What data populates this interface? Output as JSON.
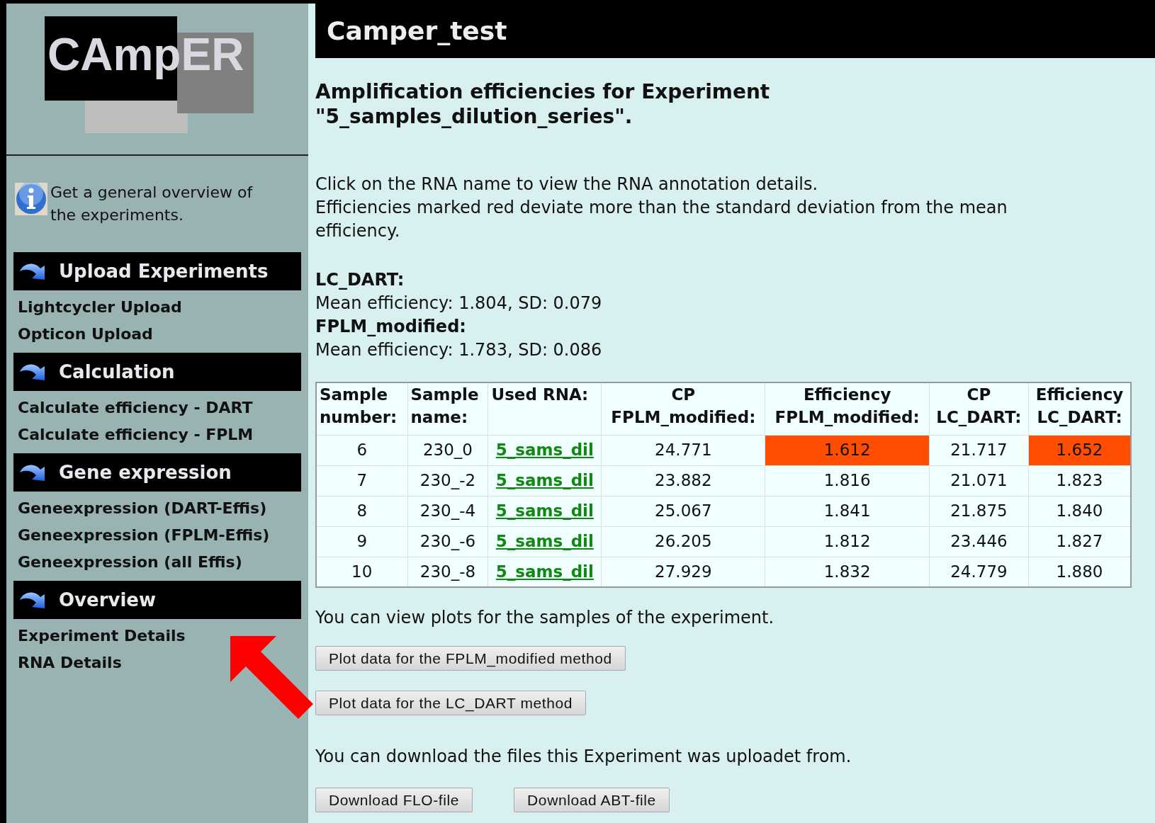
{
  "logo": {
    "text": "CAmpER"
  },
  "sidebar": {
    "info": "Get a general overview of the experiments.",
    "sections": [
      {
        "title": "Upload Experiments",
        "items": [
          "Lightcycler Upload",
          "Opticon Upload"
        ]
      },
      {
        "title": "Calculation",
        "items": [
          "Calculate efficiency - DART",
          "Calculate efficiency - FPLM"
        ]
      },
      {
        "title": "Gene expression",
        "items": [
          "Geneexpression (DART-Effis)",
          "Geneexpression (FPLM-Effis)",
          "Geneexpression (all Effis)"
        ]
      },
      {
        "title": "Overview",
        "items": [
          "Experiment Details",
          "RNA Details"
        ]
      }
    ]
  },
  "header": {
    "title": "Camper_test"
  },
  "heading": [
    "Amplification efficiencies for Experiment",
    "\"5_samples_dilution_series\"."
  ],
  "intro": [
    "Click on the RNA name to view the RNA annotation details.",
    "Efficiencies marked red deviate more than the standard deviation from the mean efficiency."
  ],
  "methods": [
    {
      "name": "LC_DART:",
      "stats": "Mean efficiency: 1.804, SD: 0.079"
    },
    {
      "name": "FPLM_modified:",
      "stats": "Mean efficiency: 1.783, SD: 0.086"
    }
  ],
  "table": {
    "columns": [
      [
        "Sample",
        "number:"
      ],
      [
        "Sample",
        "name:"
      ],
      [
        "Used RNA:"
      ],
      [
        "CP",
        "FPLM_modified:"
      ],
      [
        "Efficiency",
        "FPLM_modified:"
      ],
      [
        "CP",
        "LC_DART:"
      ],
      [
        "Efficiency",
        "LC_DART:"
      ]
    ],
    "rows": [
      {
        "number": "6",
        "name": "230_0",
        "rna": "5_sams_dil",
        "cp_fplm": "24.771",
        "eff_fplm": "1.612",
        "eff_fplm_flagged": true,
        "cp_dart": "21.717",
        "eff_dart": "1.652",
        "eff_dart_flagged": true
      },
      {
        "number": "7",
        "name": "230_-2",
        "rna": "5_sams_dil",
        "cp_fplm": "23.882",
        "eff_fplm": "1.816",
        "eff_fplm_flagged": false,
        "cp_dart": "21.071",
        "eff_dart": "1.823",
        "eff_dart_flagged": false
      },
      {
        "number": "8",
        "name": "230_-4",
        "rna": "5_sams_dil",
        "cp_fplm": "25.067",
        "eff_fplm": "1.841",
        "eff_fplm_flagged": false,
        "cp_dart": "21.875",
        "eff_dart": "1.840",
        "eff_dart_flagged": false
      },
      {
        "number": "9",
        "name": "230_-6",
        "rna": "5_sams_dil",
        "cp_fplm": "26.205",
        "eff_fplm": "1.812",
        "eff_fplm_flagged": false,
        "cp_dart": "23.446",
        "eff_dart": "1.827",
        "eff_dart_flagged": false
      },
      {
        "number": "10",
        "name": "230_-8",
        "rna": "5_sams_dil",
        "cp_fplm": "27.929",
        "eff_fplm": "1.832",
        "eff_fplm_flagged": false,
        "cp_dart": "24.779",
        "eff_dart": "1.880",
        "eff_dart_flagged": false
      }
    ]
  },
  "plots_text": "You can view plots for the samples of the experiment.",
  "plot_buttons": [
    "Plot data for the FPLM_modified method",
    "Plot data for the LC_DART method"
  ],
  "download_text": "You can download the files this Experiment was uploadet from.",
  "download_buttons": [
    "Download FLO-file",
    "Download ABT-file"
  ]
}
